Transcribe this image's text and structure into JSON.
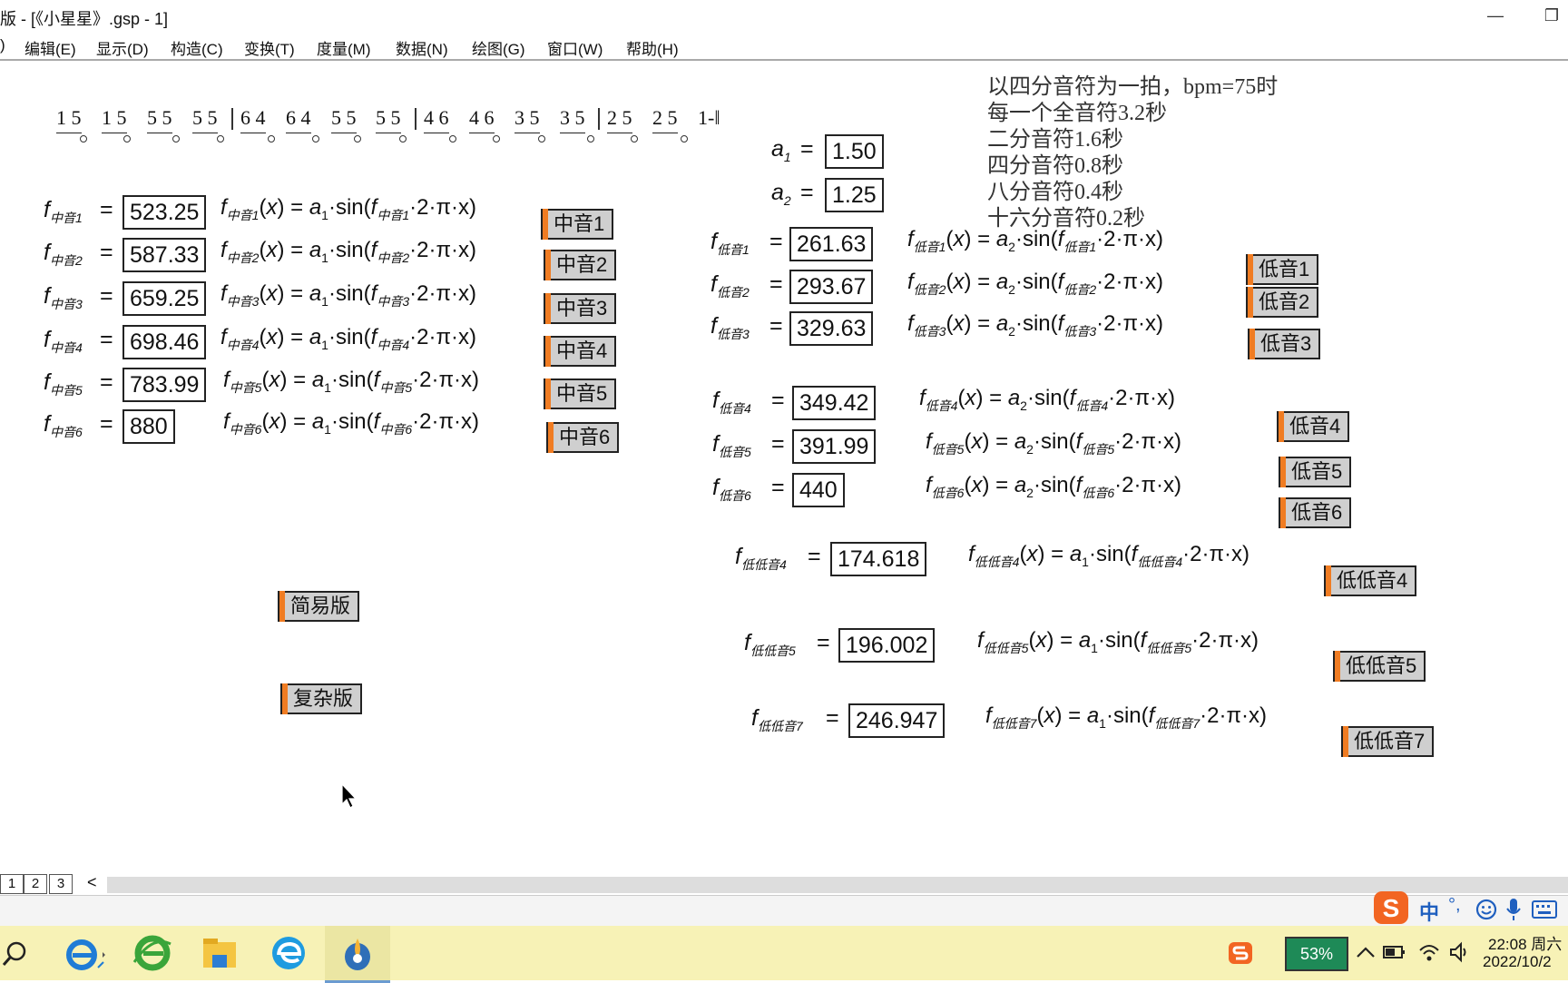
{
  "window": {
    "title": "版 - [《小星星》.gsp - 1]",
    "minimize": "—",
    "restore": "❐"
  },
  "menu": [
    "编辑(E)",
    "显示(D)",
    "构造(C)",
    "变换(T)",
    "度量(M)",
    "数据(N)",
    "绘图(G)",
    "窗口(W)",
    "帮助(H)"
  ],
  "score": {
    "groups": [
      "1 5",
      "1 5",
      "5 5",
      "5 5",
      "6 4",
      "6 4",
      "5 5",
      "5 5",
      "4 6",
      "4 6",
      "3 5",
      "3 5",
      "2 5",
      "2 5"
    ],
    "ending": "1-‖"
  },
  "notes": [
    "以四分音符为一拍，bpm=75时",
    "每一个全音符3.2秒",
    "二分音符1.6秒",
    "四分音符0.8秒",
    "八分音符0.4秒",
    "十六分音符0.2秒"
  ],
  "params": [
    {
      "symbol": "a",
      "sub": "1",
      "value": "1.50"
    },
    {
      "symbol": "a",
      "sub": "2",
      "value": "1.25"
    }
  ],
  "mid": {
    "labels": [
      "中音1",
      "中音2",
      "中音3",
      "中音4",
      "中音5",
      "中音6"
    ],
    "values": [
      "523.25",
      "587.33",
      "659.25",
      "698.46",
      "783.99",
      "880"
    ],
    "amp": "1",
    "buttons": [
      "中音1",
      "中音2",
      "中音3",
      "中音4",
      "中音5",
      "中音6"
    ]
  },
  "low": {
    "labels": [
      "低音1",
      "低音2",
      "低音3",
      "低音4",
      "低音5",
      "低音6"
    ],
    "values": [
      "261.63",
      "293.67",
      "329.63",
      "349.42",
      "391.99",
      "440"
    ],
    "amp": "2",
    "buttons": [
      "低音1",
      "低音2",
      "低音3",
      "低音4",
      "低音5",
      "低音6"
    ]
  },
  "lowlow": {
    "labels": [
      "低低音4",
      "低低音5",
      "低低音7"
    ],
    "values": [
      "174.618",
      "196.002",
      "246.947"
    ],
    "amp": "1",
    "buttons": [
      "低低音4",
      "低低音5",
      "低低音7"
    ]
  },
  "mode_buttons": {
    "simple": "简易版",
    "complex": "复杂版"
  },
  "formula_parts": {
    "f": "f",
    "sin": "sin",
    "x": "x",
    "two_pi": "2·π·x"
  },
  "pages": [
    "1",
    "2",
    "3"
  ],
  "scroll_left": "<",
  "ime": {
    "logo": "S",
    "lang": "中",
    "punct": "°,"
  },
  "taskbar": {
    "battery": "53%",
    "time": "22:08 周六",
    "date": "2022/10/2"
  },
  "colors": {
    "button_accent": "#f07c22",
    "button_face": "#cfcfcf",
    "taskbar": "#f7f2b6",
    "battery": "#1e8a57"
  }
}
